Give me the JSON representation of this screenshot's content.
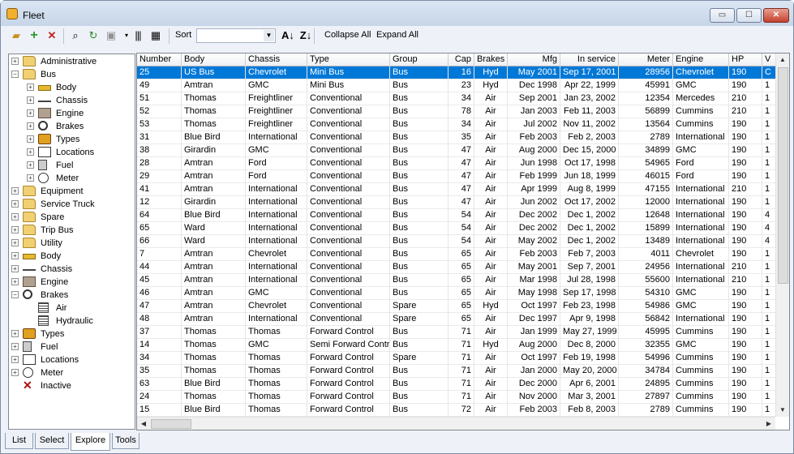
{
  "window": {
    "title": "Fleet",
    "app_icon": "bus-icon",
    "min_label": "▭",
    "max_label": "☐",
    "close_label": "✕"
  },
  "toolbar": {
    "sort_label": "Sort",
    "sort_value": "",
    "collapse_all": "Collapse All",
    "expand_all": "Expand All",
    "icons": [
      "open-folder-icon",
      "add-icon",
      "delete-icon",
      "binoculars-icon",
      "refresh-icon",
      "box-icon",
      "columns-icon",
      "barcode-icon",
      "sort-ascending-icon",
      "sort-descending-icon"
    ]
  },
  "tree": [
    {
      "label": "Administrative",
      "level": 0,
      "exp": "+",
      "icon": "folder-icon"
    },
    {
      "label": "Bus",
      "level": 0,
      "exp": "−",
      "icon": "folder-icon"
    },
    {
      "label": "Body",
      "level": 1,
      "exp": "+",
      "icon": "body-icon"
    },
    {
      "label": "Chassis",
      "level": 1,
      "exp": "+",
      "icon": "chassis-icon"
    },
    {
      "label": "Engine",
      "level": 1,
      "exp": "+",
      "icon": "engine-icon"
    },
    {
      "label": "Brakes",
      "level": 1,
      "exp": "+",
      "icon": "brakes-icon"
    },
    {
      "label": "Types",
      "level": 1,
      "exp": "+",
      "icon": "types-icon"
    },
    {
      "label": "Locations",
      "level": 1,
      "exp": "+",
      "icon": "locations-icon"
    },
    {
      "label": "Fuel",
      "level": 1,
      "exp": "+",
      "icon": "fuel-icon"
    },
    {
      "label": "Meter",
      "level": 1,
      "exp": "+",
      "icon": "meter-icon"
    },
    {
      "label": "Equipment",
      "level": 0,
      "exp": "+",
      "icon": "folder-icon"
    },
    {
      "label": "Service Truck",
      "level": 0,
      "exp": "+",
      "icon": "folder-icon"
    },
    {
      "label": "Spare",
      "level": 0,
      "exp": "+",
      "icon": "folder-icon"
    },
    {
      "label": "Trip Bus",
      "level": 0,
      "exp": "+",
      "icon": "folder-icon"
    },
    {
      "label": "Utility",
      "level": 0,
      "exp": "+",
      "icon": "folder-icon"
    },
    {
      "label": "Body",
      "level": 0,
      "exp": "+",
      "icon": "body-icon"
    },
    {
      "label": "Chassis",
      "level": 0,
      "exp": "+",
      "icon": "chassis-icon"
    },
    {
      "label": "Engine",
      "level": 0,
      "exp": "+",
      "icon": "engine-icon"
    },
    {
      "label": "Brakes",
      "level": 0,
      "exp": "−",
      "icon": "brakes-icon"
    },
    {
      "label": "Air",
      "level": 1,
      "exp": "",
      "icon": "list-icon"
    },
    {
      "label": "Hydraulic",
      "level": 1,
      "exp": "",
      "icon": "list-icon"
    },
    {
      "label": "Types",
      "level": 0,
      "exp": "+",
      "icon": "types-icon"
    },
    {
      "label": "Fuel",
      "level": 0,
      "exp": "+",
      "icon": "fuel-icon"
    },
    {
      "label": "Locations",
      "level": 0,
      "exp": "+",
      "icon": "locations-icon"
    },
    {
      "label": "Meter",
      "level": 0,
      "exp": "+",
      "icon": "meter-icon"
    },
    {
      "label": "Inactive",
      "level": 0,
      "exp": "",
      "icon": "inactive-x-icon"
    }
  ],
  "grid": {
    "columns": [
      "Number",
      "Body",
      "Chassis",
      "Type",
      "Group",
      "Cap",
      "Brakes",
      "Mfg",
      "In service",
      "Meter",
      "Engine",
      "HP",
      "V"
    ],
    "rows": [
      [
        "25",
        "US Bus",
        "Chevrolet",
        "Mini Bus",
        "Bus",
        "16",
        "Hyd",
        "May 2001",
        "Sep 17, 2001",
        "28956",
        "Chevrolet",
        "190",
        "C"
      ],
      [
        "49",
        "Amtran",
        "GMC",
        "Mini Bus",
        "Bus",
        "23",
        "Hyd",
        "Dec 1998",
        "Apr 22, 1999",
        "45991",
        "GMC",
        "190",
        "1"
      ],
      [
        "51",
        "Thomas",
        "Freightliner",
        "Conventional",
        "Bus",
        "34",
        "Air",
        "Sep 2001",
        "Jan 23, 2002",
        "12354",
        "Mercedes",
        "210",
        "1"
      ],
      [
        "52",
        "Thomas",
        "Freightliner",
        "Conventional",
        "Bus",
        "78",
        "Air",
        "Jan 2003",
        "Feb 11, 2003",
        "56899",
        "Cummins",
        "210",
        "1"
      ],
      [
        "53",
        "Thomas",
        "Freightliner",
        "Conventional",
        "Bus",
        "34",
        "Air",
        "Jul 2002",
        "Nov 11, 2002",
        "13564",
        "Cummins",
        "190",
        "1"
      ],
      [
        "31",
        "Blue Bird",
        "International",
        "Conventional",
        "Bus",
        "35",
        "Air",
        "Feb 2003",
        "Feb 2, 2003",
        "2789",
        "International",
        "190",
        "1"
      ],
      [
        "38",
        "Girardin",
        "GMC",
        "Conventional",
        "Bus",
        "47",
        "Air",
        "Aug 2000",
        "Dec 15, 2000",
        "34899",
        "GMC",
        "190",
        "1"
      ],
      [
        "28",
        "Amtran",
        "Ford",
        "Conventional",
        "Bus",
        "47",
        "Air",
        "Jun 1998",
        "Oct 17, 1998",
        "54965",
        "Ford",
        "190",
        "1"
      ],
      [
        "29",
        "Amtran",
        "Ford",
        "Conventional",
        "Bus",
        "47",
        "Air",
        "Feb 1999",
        "Jun 18, 1999",
        "46015",
        "Ford",
        "190",
        "1"
      ],
      [
        "41",
        "Amtran",
        "International",
        "Conventional",
        "Bus",
        "47",
        "Air",
        "Apr 1999",
        "Aug 8, 1999",
        "47155",
        "International",
        "210",
        "1"
      ],
      [
        "12",
        "Girardin",
        "International",
        "Conventional",
        "Bus",
        "47",
        "Air",
        "Jun 2002",
        "Oct 17, 2002",
        "12000",
        "International",
        "190",
        "1"
      ],
      [
        "64",
        "Blue Bird",
        "International",
        "Conventional",
        "Bus",
        "54",
        "Air",
        "Dec 2002",
        "Dec 1, 2002",
        "12648",
        "International",
        "190",
        "4"
      ],
      [
        "65",
        "Ward",
        "International",
        "Conventional",
        "Bus",
        "54",
        "Air",
        "Dec 2002",
        "Dec 1, 2002",
        "15899",
        "International",
        "190",
        "4"
      ],
      [
        "66",
        "Ward",
        "International",
        "Conventional",
        "Bus",
        "54",
        "Air",
        "May 2002",
        "Dec 1, 2002",
        "13489",
        "International",
        "190",
        "4"
      ],
      [
        "7",
        "Amtran",
        "Chevrolet",
        "Conventional",
        "Bus",
        "65",
        "Air",
        "Feb 2003",
        "Feb 7, 2003",
        "4011",
        "Chevrolet",
        "190",
        "1"
      ],
      [
        "44",
        "Amtran",
        "International",
        "Conventional",
        "Bus",
        "65",
        "Air",
        "May 2001",
        "Sep 7, 2001",
        "24956",
        "International",
        "210",
        "1"
      ],
      [
        "45",
        "Amtran",
        "International",
        "Conventional",
        "Bus",
        "65",
        "Air",
        "Mar 1998",
        "Jul 28, 1998",
        "55600",
        "International",
        "210",
        "1"
      ],
      [
        "46",
        "Amtran",
        "GMC",
        "Conventional",
        "Bus",
        "65",
        "Air",
        "May 1998",
        "Sep 17, 1998",
        "54310",
        "GMC",
        "190",
        "1"
      ],
      [
        "47",
        "Amtran",
        "Chevrolet",
        "Conventional",
        "Spare",
        "65",
        "Hyd",
        "Oct 1997",
        "Feb 23, 1998",
        "54986",
        "GMC",
        "190",
        "1"
      ],
      [
        "48",
        "Amtran",
        "International",
        "Conventional",
        "Spare",
        "65",
        "Air",
        "Dec 1997",
        "Apr 9, 1998",
        "56842",
        "International",
        "190",
        "1"
      ],
      [
        "37",
        "Thomas",
        "Thomas",
        "Forward Control",
        "Bus",
        "71",
        "Air",
        "Jan 1999",
        "May 27, 1999",
        "45995",
        "Cummins",
        "190",
        "1"
      ],
      [
        "14",
        "Thomas",
        "GMC",
        "Semi Forward Control",
        "Bus",
        "71",
        "Hyd",
        "Aug 2000",
        "Dec 8, 2000",
        "32355",
        "GMC",
        "190",
        "1"
      ],
      [
        "34",
        "Thomas",
        "Thomas",
        "Forward Control",
        "Spare",
        "71",
        "Air",
        "Oct 1997",
        "Feb 19, 1998",
        "54996",
        "Cummins",
        "190",
        "1"
      ],
      [
        "35",
        "Thomas",
        "Thomas",
        "Forward Control",
        "Bus",
        "71",
        "Air",
        "Jan 2000",
        "May 20, 2000",
        "34784",
        "Cummins",
        "190",
        "1"
      ],
      [
        "63",
        "Blue Bird",
        "Thomas",
        "Forward Control",
        "Bus",
        "71",
        "Air",
        "Dec 2000",
        "Apr 6, 2001",
        "24895",
        "Cummins",
        "190",
        "1"
      ],
      [
        "24",
        "Thomas",
        "Thomas",
        "Forward Control",
        "Bus",
        "71",
        "Air",
        "Nov 2000",
        "Mar 3, 2001",
        "27897",
        "Cummins",
        "190",
        "1"
      ],
      [
        "15",
        "Blue Bird",
        "Thomas",
        "Forward Control",
        "Bus",
        "72",
        "Air",
        "Feb 2003",
        "Feb 8, 2003",
        "2789",
        "Cummins",
        "190",
        "1"
      ]
    ],
    "selected_row": 0
  },
  "tabs": [
    {
      "label": "List",
      "active": false
    },
    {
      "label": "Select",
      "active": false
    },
    {
      "label": "Explore",
      "active": true
    },
    {
      "label": "Tools",
      "active": false
    }
  ],
  "colors": {
    "selection": "#0078d7",
    "title_bar": "#c6d5e8",
    "window_bg": "#eef2f8"
  }
}
